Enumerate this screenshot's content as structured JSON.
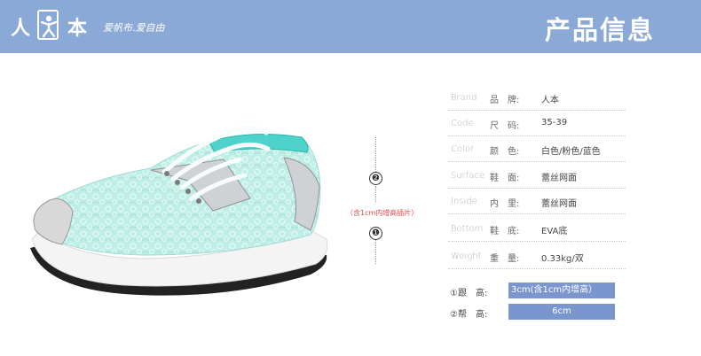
{
  "header": {
    "logo_left": "人",
    "logo_right": "本",
    "slogan": "爱帆布.爱自由",
    "title": "产品信息"
  },
  "product": {
    "marker_1": "❶",
    "marker_2": "❷",
    "note": "（含1cm内增高插片）"
  },
  "specs": [
    {
      "en": "Brand",
      "cn": "品　牌:",
      "value": "人本"
    },
    {
      "en": "Code",
      "cn": "尺　码:",
      "value": "35-39"
    },
    {
      "en": "Color",
      "cn": "颜　色:",
      "value": "白色/粉色/蓝色"
    },
    {
      "en": "Surface",
      "cn": "鞋　面:",
      "value": "蕾丝网面"
    },
    {
      "en": "Inside",
      "cn": "内　里:",
      "value": "蕾丝网面"
    },
    {
      "en": "Bottom",
      "cn": "鞋　底:",
      "value": "EVA底"
    },
    {
      "en": "Weight",
      "cn": "重　量:",
      "value": "0.33kg/双"
    }
  ],
  "sizes": [
    {
      "label": "①跟　高:",
      "value": "3cm(含1cm内增高）"
    },
    {
      "label": "②帮　高:",
      "value": "6cm"
    }
  ],
  "colors": {
    "banner": "#8aa9d6",
    "size_bar": "#7b96cf",
    "note": "#e04b4b",
    "shoe_lace": "#9ee3d4"
  }
}
